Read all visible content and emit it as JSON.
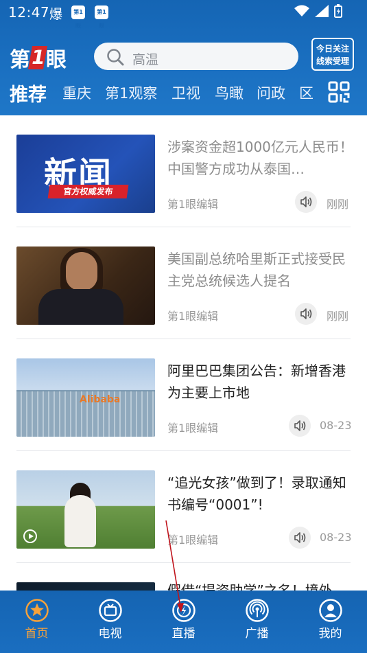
{
  "status_bar": {
    "time": "12:47",
    "extra_glyph": "爆",
    "app_badges": [
      "第1眼",
      "第1眼"
    ]
  },
  "header": {
    "logo": {
      "part1": "第",
      "one": "1",
      "part2": "眼"
    },
    "search": {
      "placeholder": "高温"
    },
    "clue_button": {
      "line1": "今日关注",
      "line2": "线索受理"
    },
    "tabs": [
      {
        "label": "推荐",
        "active": true
      },
      {
        "label": "重庆"
      },
      {
        "label": "第1观察"
      },
      {
        "label": "卫视"
      },
      {
        "label": "鸟瞰"
      },
      {
        "label": "问政"
      },
      {
        "label": "区"
      }
    ]
  },
  "news": [
    {
      "title": "涉案资金超1000亿元人民币！中国警方成功从泰国…",
      "source": "第1眼编辑",
      "time": "刚刚",
      "read": true,
      "thumb_big": "新闻",
      "thumb_badge": "官方权威发布"
    },
    {
      "title": "美国副总统哈里斯正式接受民主党总统候选人提名",
      "source": "第1眼编辑",
      "time": "刚刚",
      "read": true
    },
    {
      "title": "阿里巴巴集团公告：新增香港为主要上市地",
      "source": "第1眼编辑",
      "time": "08-23",
      "read": false,
      "thumb_logo": "Alibaba"
    },
    {
      "title": "“追光女孩”做到了！录取通知书编号“0001”!",
      "source": "第1眼编辑",
      "time": "08-23",
      "read": false
    },
    {
      "title": "假借“提资助学”之名！境外",
      "source": "",
      "time": "",
      "read": false
    }
  ],
  "bottom_nav": [
    {
      "label": "首页",
      "icon": "star-icon",
      "active": true
    },
    {
      "label": "电视",
      "icon": "tv-icon"
    },
    {
      "label": "直播",
      "icon": "live-icon"
    },
    {
      "label": "广播",
      "icon": "broadcast-icon"
    },
    {
      "label": "我的",
      "icon": "profile-icon"
    }
  ],
  "colors": {
    "header_blue": "#1565b4",
    "active_nav": "#f7a23a",
    "annotation_arrow": "#c0141c"
  }
}
